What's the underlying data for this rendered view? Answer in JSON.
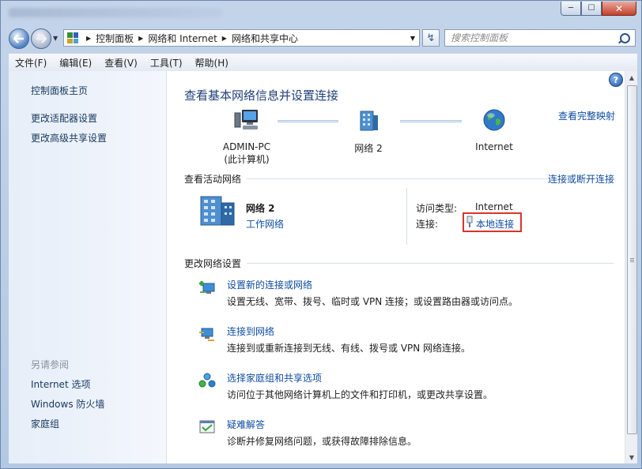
{
  "window": {
    "controls": {
      "minimize": "─",
      "maximize": "☐",
      "close": "✕"
    }
  },
  "address": {
    "crumbs": [
      "控制面板",
      "网络和 Internet",
      "网络和共享中心"
    ],
    "search_placeholder": "搜索控制面板"
  },
  "menu": [
    "文件(F)",
    "编辑(E)",
    "查看(V)",
    "工具(T)",
    "帮助(H)"
  ],
  "sidebar": {
    "links": [
      "控制面板主页",
      "更改适配器设置",
      "更改高级共享设置"
    ],
    "see_also_heading": "另请参阅",
    "see_also": [
      "Internet 选项",
      "Windows 防火墙",
      "家庭组"
    ]
  },
  "main": {
    "title": "查看基本网络信息并设置连接",
    "view_full_map": "查看完整映射",
    "nodes": [
      {
        "line1": "ADMIN-PC",
        "line2": "(此计算机)"
      },
      {
        "line1": "网络  2",
        "line2": ""
      },
      {
        "line1": "Internet",
        "line2": ""
      }
    ],
    "active_networks_label": "查看活动网络",
    "connect_or_disconnect": "连接或断开连接",
    "active_network": {
      "name": "网络  2",
      "type_link": "工作网络",
      "access_type_label": "访问类型:",
      "access_type_value": "Internet",
      "connections_label": "连接:",
      "connection_link": "本地连接"
    },
    "change_settings_label": "更改网络设置",
    "tasks": [
      {
        "title": "设置新的连接或网络",
        "desc": "设置无线、宽带、拨号、临时或 VPN 连接；或设置路由器或访问点。",
        "icon": "new-connection-icon"
      },
      {
        "title": "连接到网络",
        "desc": "连接到或重新连接到无线、有线、拨号或 VPN 网络连接。",
        "icon": "connect-network-icon"
      },
      {
        "title": "选择家庭组和共享选项",
        "desc": "访问位于其他网络计算机上的文件和打印机，或更改共享设置。",
        "icon": "homegroup-icon"
      },
      {
        "title": "疑难解答",
        "desc": "诊断并修复网络问题，或获得故障排除信息。",
        "icon": "troubleshoot-icon"
      }
    ]
  },
  "colors": {
    "link": "#0f4da1",
    "title": "#1e3f78",
    "highlight": "#d8342c"
  }
}
